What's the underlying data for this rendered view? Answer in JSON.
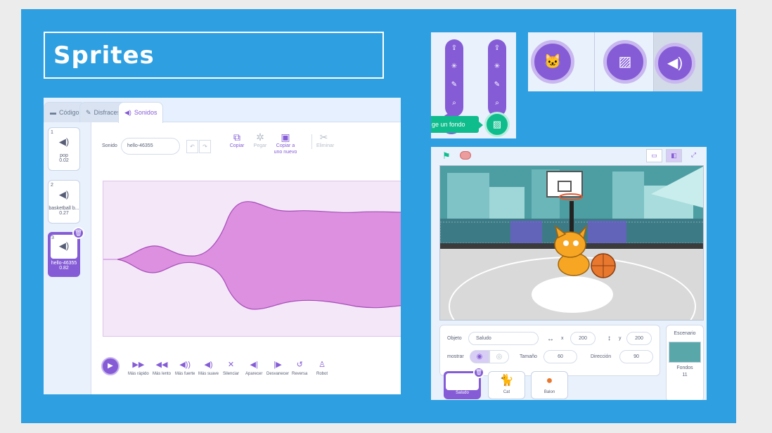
{
  "slide": {
    "title": "Sprites"
  },
  "sounds_editor": {
    "tabs": [
      {
        "icon": "code-icon",
        "label": "Código"
      },
      {
        "icon": "brush-icon",
        "label": "Disfraces"
      },
      {
        "icon": "speaker-icon",
        "label": "Sonidos"
      }
    ],
    "sound_list": [
      {
        "number": "1",
        "name": "pop",
        "duration": "0.02"
      },
      {
        "number": "2",
        "name": "basketball b...",
        "duration": "0.27"
      },
      {
        "number": "3",
        "name": "hello-46355",
        "duration": "0.82"
      }
    ],
    "name_label": "Sonido",
    "name_value": "hello-46355",
    "tools": [
      {
        "icon": "copy-icon",
        "label": "Copiar",
        "enabled": true
      },
      {
        "icon": "paste-icon",
        "label": "Pegar",
        "enabled": false
      },
      {
        "icon": "copy-new-icon",
        "label": "Copiar a uno nuevo",
        "enabled": true
      },
      {
        "icon": "scissors-icon",
        "label": "Eliminar",
        "enabled": false
      }
    ],
    "effects": [
      "Más rápido",
      "Más lento",
      "Más fuerte",
      "Más suave",
      "Silenciar",
      "Aparecer",
      "Desvanecer",
      "Reversa",
      "Robot"
    ]
  },
  "backdrop_menu": {
    "menu_icons": [
      "upload-icon",
      "surprise-icon",
      "paint-icon",
      "search-icon"
    ],
    "tooltip": "ge un fondo"
  },
  "stage_panel": {
    "sprite_label": "Objeto",
    "sprite_name": "Saludo",
    "x_label": "x",
    "x_value": "200",
    "y_label": "y",
    "y_value": "200",
    "show_label": "mostrar",
    "size_label": "Tamaño",
    "size_value": "60",
    "direction_label": "Dirección",
    "direction_value": "90",
    "sprites": [
      {
        "name": "Saludo",
        "icon": "sign-sprite-icon"
      },
      {
        "name": "Cat",
        "icon": "cat-sprite-icon"
      },
      {
        "name": "Balon",
        "icon": "basketball-sprite-icon"
      }
    ],
    "stage_label": "Escenario",
    "backdrops_label": "Fondos",
    "backdrops_count": "11"
  },
  "colors": {
    "slide_bg": "#2e9fe0",
    "scratch_purple": "#855cd6",
    "scratch_green": "#0fbd8c"
  }
}
